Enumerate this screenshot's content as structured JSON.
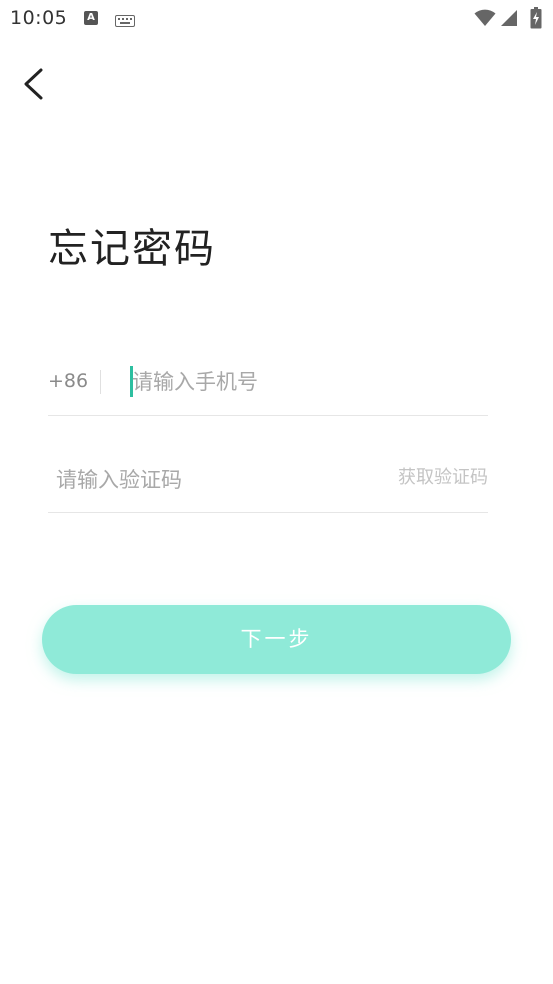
{
  "status_bar": {
    "time": "10:05",
    "a_icon_letter": "A",
    "icons": [
      "a-notification-icon",
      "keyboard-icon",
      "wifi-icon",
      "signal-icon",
      "battery-charging-icon"
    ]
  },
  "header": {
    "back_icon": "chevron-left-icon"
  },
  "page": {
    "title": "忘记密码"
  },
  "form": {
    "country_code": "+86",
    "phone_placeholder": "请输入手机号",
    "phone_value": "",
    "code_placeholder": "请输入验证码",
    "code_value": "",
    "get_code_label": "获取验证码",
    "next_label": "下一步"
  },
  "colors": {
    "accent": "#8fead8",
    "cursor": "#2dbfa0",
    "placeholder": "#a8a8a8",
    "divider": "#e6e6e6"
  }
}
